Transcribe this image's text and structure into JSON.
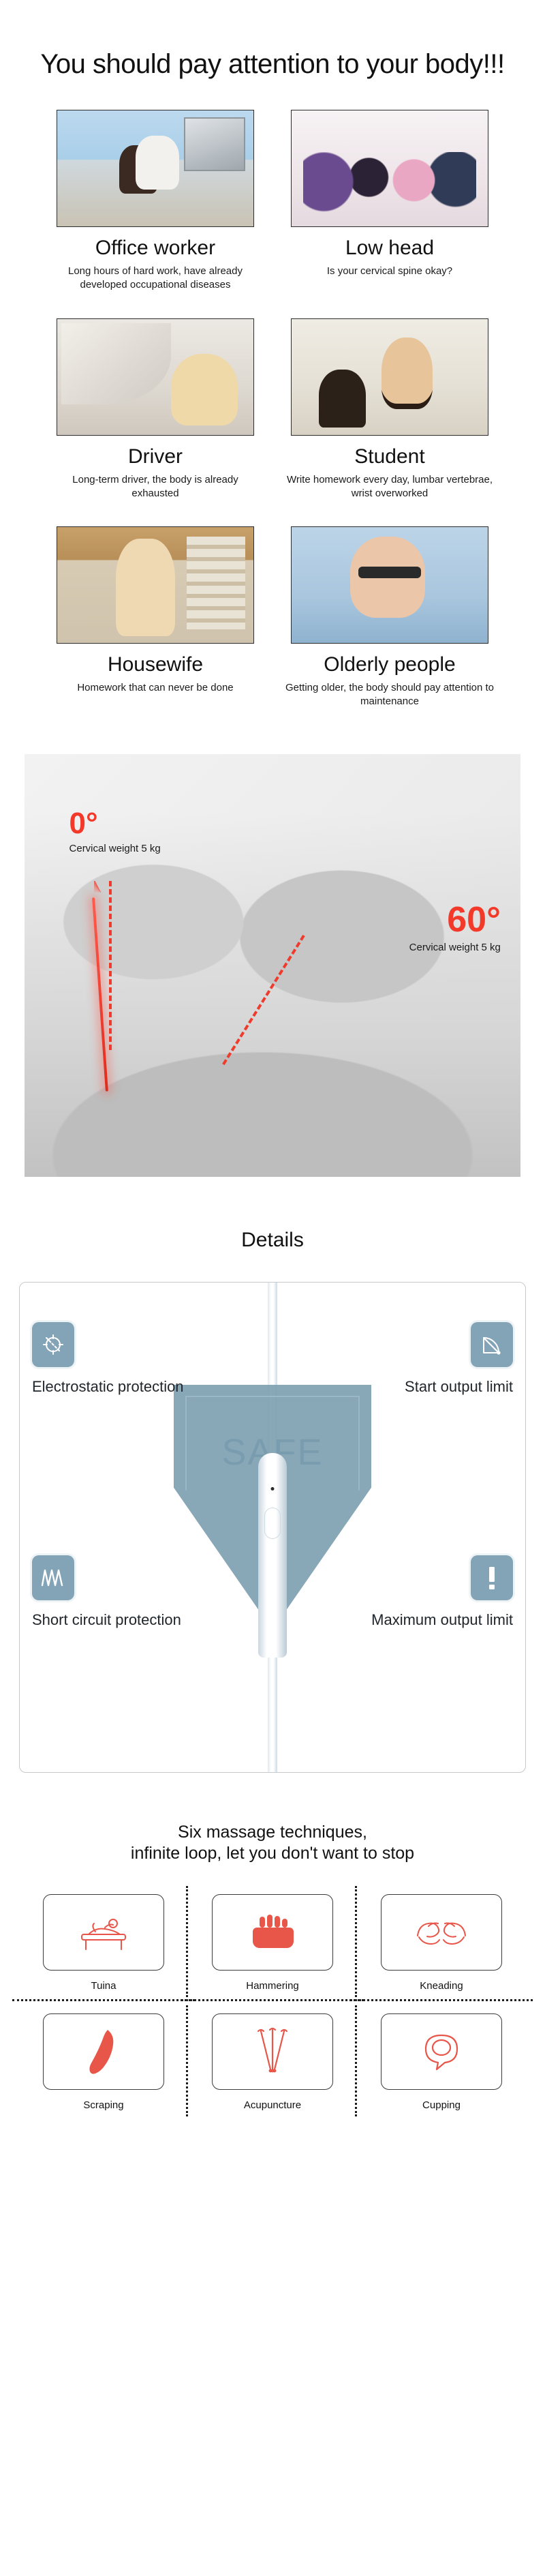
{
  "hero": {
    "title": "You should pay attention to your body!!!"
  },
  "personas": [
    {
      "name": "Office worker",
      "desc": "Long hours of hard work, have already developed occupational diseases",
      "photo": "office-worker-slumped-at-desk-photo",
      "scene_class": "sc-office"
    },
    {
      "name": "Low head",
      "desc": "Is your cervical spine okay?",
      "photo": "people-looking-down-at-phones-photo",
      "scene_class": "sc-lowhead"
    },
    {
      "name": "Driver",
      "desc": "Long-term driver, the body is already exhausted",
      "photo": "tired-driver-in-car-photo",
      "scene_class": "sc-driver"
    },
    {
      "name": "Student",
      "desc": "Write homework every day, lumbar vertebrae, wrist overworked",
      "photo": "student-in-classroom-photo",
      "scene_class": "sc-student"
    },
    {
      "name": "Housewife",
      "desc": "Homework that can never be done",
      "photo": "housewife-in-kitchen-photo",
      "scene_class": "sc-housewife"
    },
    {
      "name": "Olderly people",
      "desc": "Getting older, the body should pay attention to maintenance",
      "photo": "elderly-man-holding-head-photo",
      "scene_class": "sc-elderly"
    }
  ],
  "angle_section": {
    "image_name": "cervical-spine-angle-illustration",
    "accent_color": "#f2392a",
    "left": {
      "degrees": "0°",
      "caption": "Cervical weight 5 kg"
    },
    "right": {
      "degrees": "60°",
      "caption": "Cervical weight 5 kg"
    }
  },
  "details": {
    "title": "Details",
    "shield_word": "SAFE",
    "icon_color": "#83a4b6",
    "features": [
      {
        "label": "Electrostatic protection",
        "icon": "electrostatic-icon"
      },
      {
        "label": "Start output limit",
        "icon": "angle-meter-icon"
      },
      {
        "label": "Short circuit protection",
        "icon": "waveform-icon"
      },
      {
        "label": "Maximum output limit",
        "icon": "exclamation-icon"
      }
    ]
  },
  "techniques": {
    "heading_line1": "Six massage techniques,",
    "heading_line2": "infinite loop, let you don't want to stop",
    "icon_color": "#e8564a",
    "items": [
      {
        "name": "Tuina",
        "icon": "tuina-massage-table-icon"
      },
      {
        "name": "Hammering",
        "icon": "fist-hammering-icon"
      },
      {
        "name": "Kneading",
        "icon": "kneading-hands-icon"
      },
      {
        "name": "Scraping",
        "icon": "gua-sha-scraping-tool-icon"
      },
      {
        "name": "Acupuncture",
        "icon": "acupuncture-needles-icon"
      },
      {
        "name": "Cupping",
        "icon": "cupping-glass-icon"
      }
    ]
  }
}
